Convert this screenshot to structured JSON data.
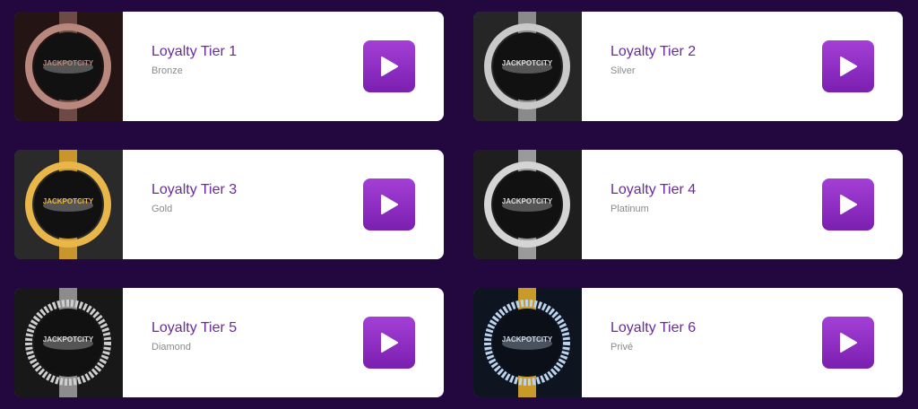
{
  "tiers": [
    {
      "title": "Loyalty Tier 1",
      "subtitle": "Bronze",
      "logo": "JACKPOTCITY",
      "colors": {
        "ring": "#b8877e",
        "band": "#6e4a44",
        "bg": "#241414"
      }
    },
    {
      "title": "Loyalty Tier 2",
      "subtitle": "Silver",
      "logo": "JACKPOTCITY",
      "colors": {
        "ring": "#c9c9c9",
        "band": "#8a8a8a",
        "bg": "#262626"
      }
    },
    {
      "title": "Loyalty Tier 3",
      "subtitle": "Gold",
      "logo": "JACKPOTCITY",
      "colors": {
        "ring": "#e9b64a",
        "band": "#c9962e",
        "bg": "#2a2a2a"
      }
    },
    {
      "title": "Loyalty Tier 4",
      "subtitle": "Platinum",
      "logo": "JACKPOTCITY",
      "colors": {
        "ring": "#d5d5d5",
        "band": "#9a9a9a",
        "bg": "#1e1e1e"
      }
    },
    {
      "title": "Loyalty Tier 5",
      "subtitle": "Diamond",
      "logo": "JACKPOTCITY",
      "colors": {
        "ring": "#cfcfcf",
        "band": "#8c8c8c",
        "bg": "#181818"
      }
    },
    {
      "title": "Loyalty Tier 6",
      "subtitle": "Privé",
      "logo": "JACKPOTCITY",
      "colors": {
        "ring": "#bcd4ee",
        "band": "#c89a2a",
        "bg": "#0e1420"
      }
    }
  ],
  "colors": {
    "page_bg": "#22083f",
    "title": "#6b2a9c",
    "subtitle": "#8a8a8a",
    "button": "#8b2cc4"
  },
  "icons": {
    "play": "play-icon"
  }
}
